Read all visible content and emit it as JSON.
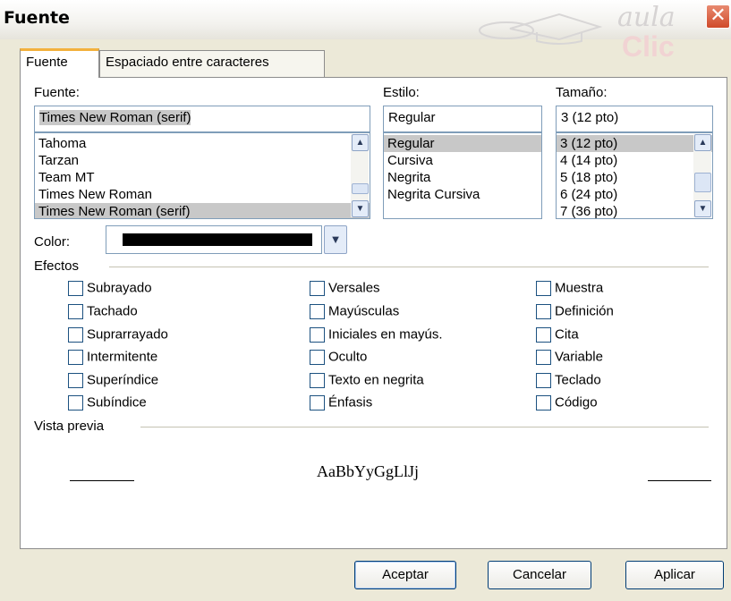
{
  "window": {
    "title": "Fuente",
    "close_glyph": "✕"
  },
  "watermark": {
    "line1": "aula",
    "line2": "Clic",
    "icon": "mouse-graduation-cap-logo"
  },
  "tabs": [
    {
      "label": "Fuente",
      "active": true
    },
    {
      "label": "Espaciado entre caracteres",
      "active": false
    }
  ],
  "font": {
    "label": "Fuente:",
    "value": "Times New Roman (serif)",
    "items": [
      "Tahoma",
      "Tarzan",
      "Team MT",
      "Times New Roman",
      "Times New Roman (serif)"
    ],
    "selected": "Times New Roman (serif)"
  },
  "style": {
    "label": "Estilo:",
    "value": "Regular",
    "items": [
      "Regular",
      "Cursiva",
      "Negrita",
      "Negrita Cursiva"
    ],
    "selected": "Regular"
  },
  "size": {
    "label": "Tamaño:",
    "value": "3  (12 pto)",
    "items": [
      "3  (12 pto)",
      "4  (14 pto)",
      "5  (18 pto)",
      "6  (24 pto)",
      "7  (36 pto)"
    ],
    "selected": "3  (12 pto)"
  },
  "color": {
    "label": "Color:",
    "value": "#000000"
  },
  "effects": {
    "label": "Efectos",
    "columns": [
      [
        "Subrayado",
        "Tachado",
        "Suprarrayado",
        "Intermitente",
        "Superíndice",
        "Subíndice"
      ],
      [
        "Versales",
        "Mayúsculas",
        "Iniciales en mayús.",
        "Oculto",
        "Texto en negrita",
        "Énfasis"
      ],
      [
        "Muestra",
        "Definición",
        "Cita",
        "Variable",
        "Teclado",
        "Código"
      ]
    ]
  },
  "preview": {
    "label": "Vista previa",
    "sample": "AaBbYyGgLlJj"
  },
  "buttons": {
    "ok": "Aceptar",
    "cancel": "Cancelar",
    "apply": "Aplicar"
  },
  "colors": {
    "dialog_bg": "#ece9d8",
    "tab_accent": "#f3b13c",
    "close_button": "#d04a2a",
    "selection": "#c8c8c8"
  }
}
